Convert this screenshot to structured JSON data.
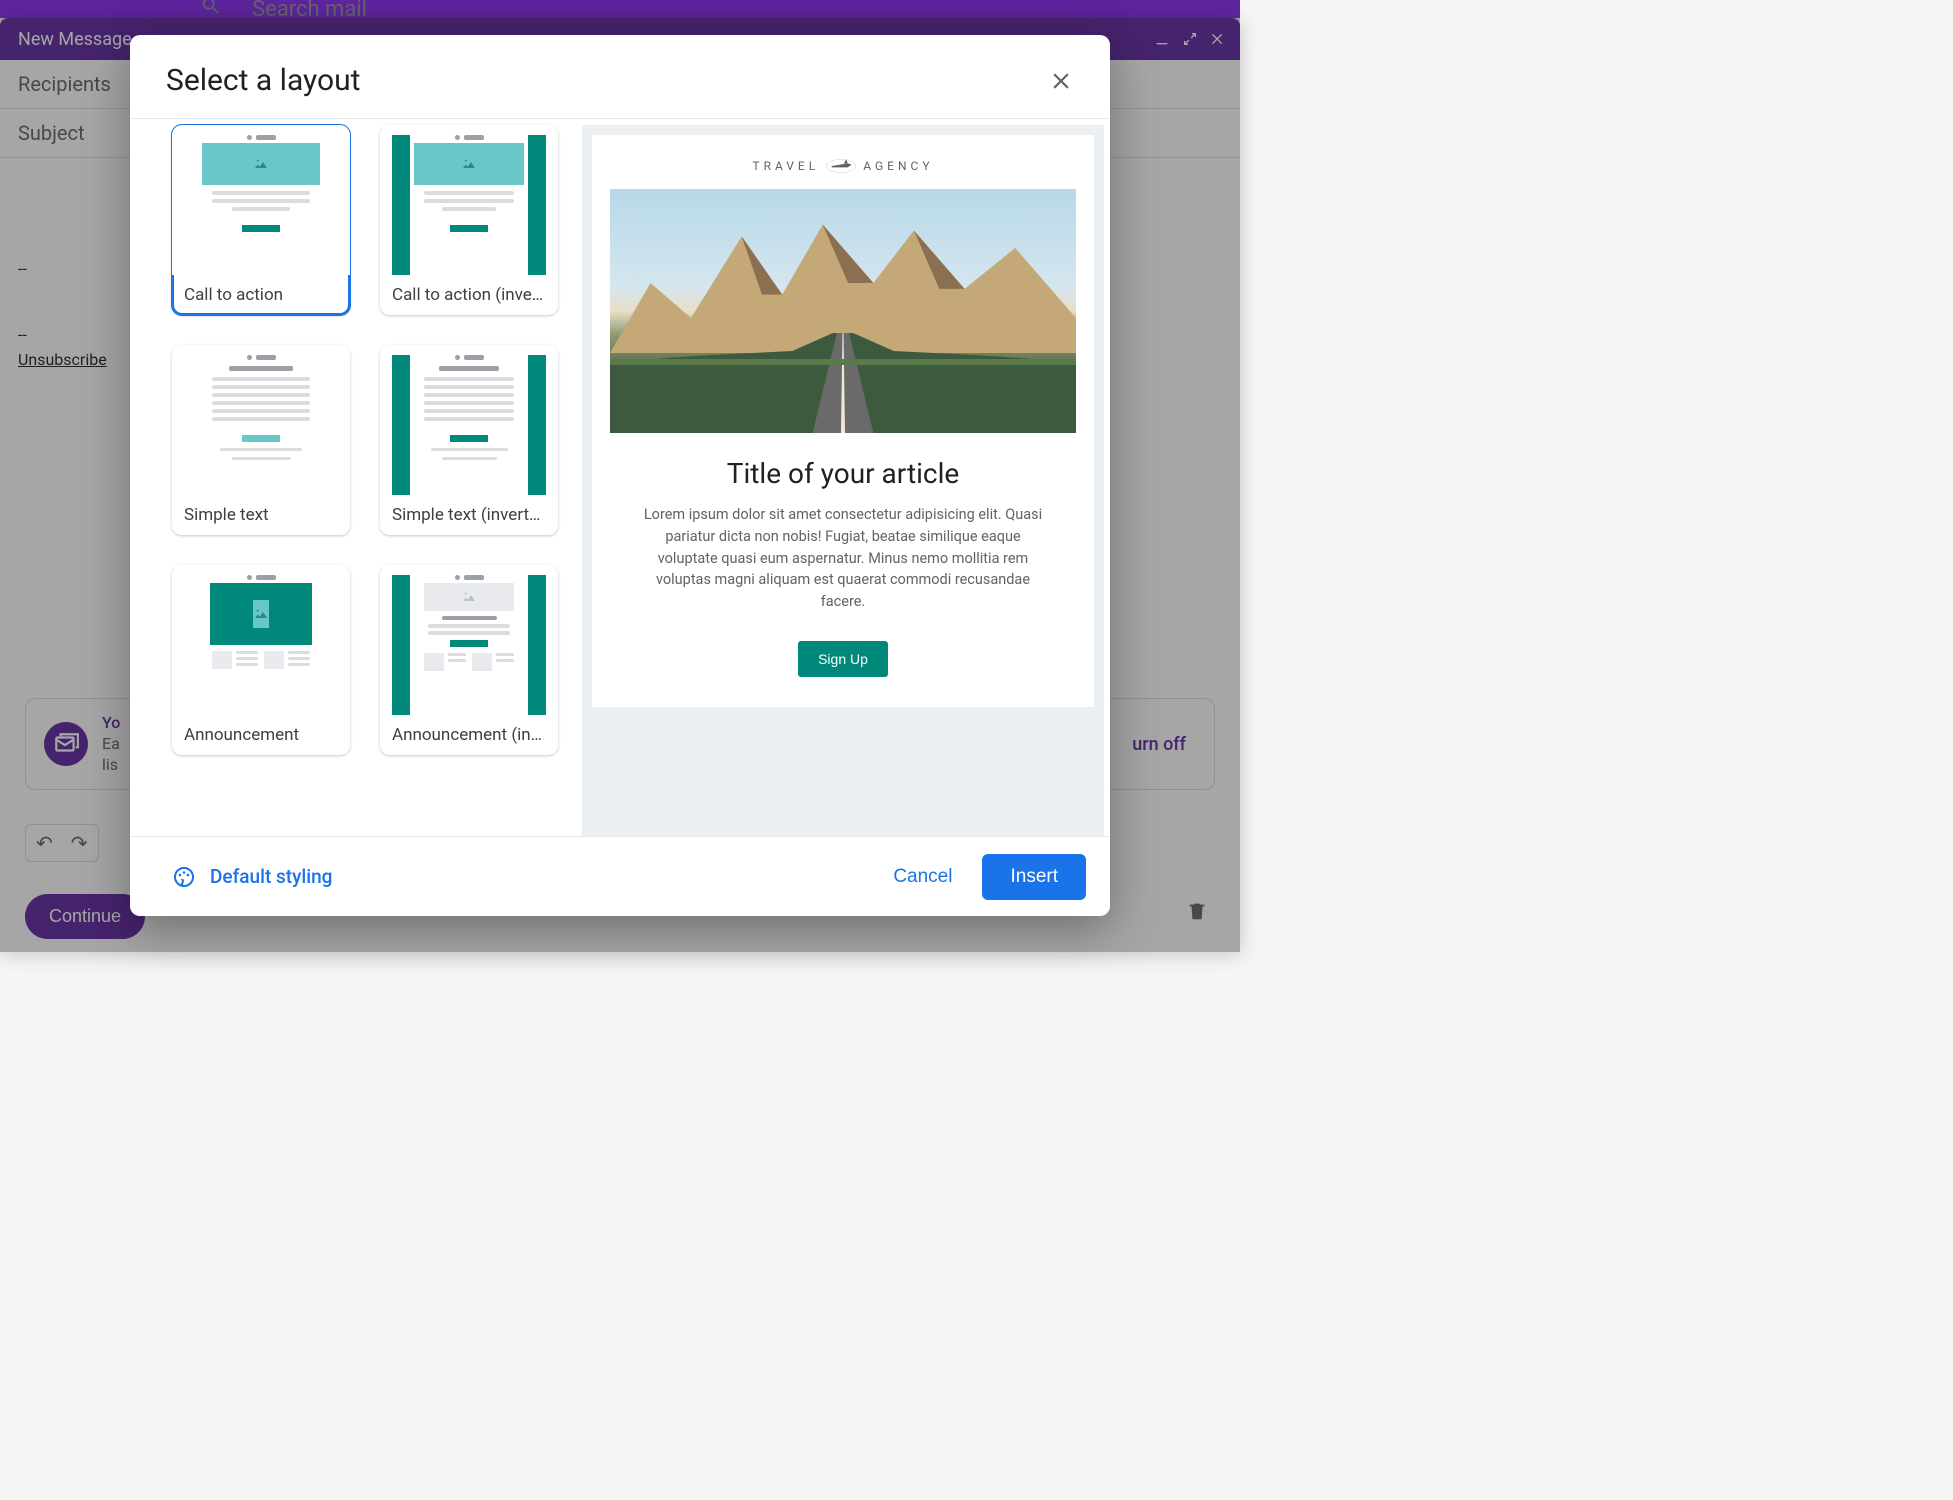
{
  "app": {
    "search_placeholder": "Search mail"
  },
  "compose": {
    "title": "New Message",
    "recipients_label": "Recipients",
    "subject_label": "Subject",
    "body_dashes1": "--",
    "body_dashes2": "--",
    "unsubscribe": "Unsubscribe",
    "multisend_title": "Yo",
    "multisend_line1": "Ea",
    "multisend_line2": "lis",
    "turn_off": "urn off",
    "continue": "Continue"
  },
  "modal": {
    "title": "Select a layout",
    "layouts": [
      {
        "label": "Call to action",
        "selected": true
      },
      {
        "label": "Call to action (inve…",
        "selected": false
      },
      {
        "label": "Simple text",
        "selected": false
      },
      {
        "label": "Simple text (invert…",
        "selected": false
      },
      {
        "label": "Announcement",
        "selected": false
      },
      {
        "label": "Announcement (in…",
        "selected": false
      }
    ],
    "preview": {
      "logo_left": "TRAVEL",
      "logo_right": "AGENCY",
      "title": "Title of your article",
      "body": "Lorem ipsum dolor sit amet consectetur adipisicing elit. Quasi pariatur dicta non nobis! Fugiat, beatae similique eaque voluptate quasi eum aspernatur. Minus nemo mollitia rem voluptas magni aliquam est quaerat commodi recusandae facere.",
      "cta": "Sign Up"
    },
    "default_styling": "Default styling",
    "cancel": "Cancel",
    "insert": "Insert"
  }
}
